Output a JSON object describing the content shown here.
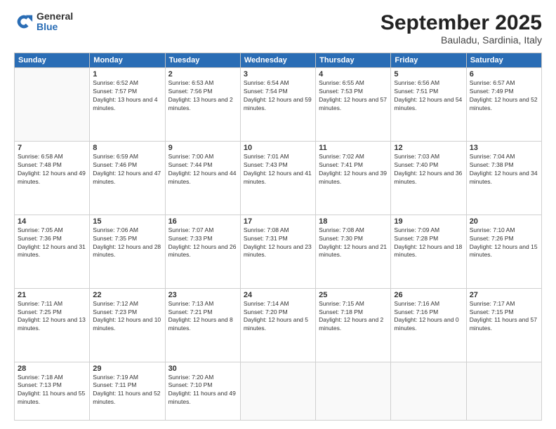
{
  "logo": {
    "general": "General",
    "blue": "Blue"
  },
  "header": {
    "month": "September 2025",
    "location": "Bauladu, Sardinia, Italy"
  },
  "days_of_week": [
    "Sunday",
    "Monday",
    "Tuesday",
    "Wednesday",
    "Thursday",
    "Friday",
    "Saturday"
  ],
  "weeks": [
    [
      {
        "day": "",
        "sunrise": "",
        "sunset": "",
        "daylight": ""
      },
      {
        "day": "1",
        "sunrise": "Sunrise: 6:52 AM",
        "sunset": "Sunset: 7:57 PM",
        "daylight": "Daylight: 13 hours and 4 minutes."
      },
      {
        "day": "2",
        "sunrise": "Sunrise: 6:53 AM",
        "sunset": "Sunset: 7:56 PM",
        "daylight": "Daylight: 13 hours and 2 minutes."
      },
      {
        "day": "3",
        "sunrise": "Sunrise: 6:54 AM",
        "sunset": "Sunset: 7:54 PM",
        "daylight": "Daylight: 12 hours and 59 minutes."
      },
      {
        "day": "4",
        "sunrise": "Sunrise: 6:55 AM",
        "sunset": "Sunset: 7:53 PM",
        "daylight": "Daylight: 12 hours and 57 minutes."
      },
      {
        "day": "5",
        "sunrise": "Sunrise: 6:56 AM",
        "sunset": "Sunset: 7:51 PM",
        "daylight": "Daylight: 12 hours and 54 minutes."
      },
      {
        "day": "6",
        "sunrise": "Sunrise: 6:57 AM",
        "sunset": "Sunset: 7:49 PM",
        "daylight": "Daylight: 12 hours and 52 minutes."
      }
    ],
    [
      {
        "day": "7",
        "sunrise": "Sunrise: 6:58 AM",
        "sunset": "Sunset: 7:48 PM",
        "daylight": "Daylight: 12 hours and 49 minutes."
      },
      {
        "day": "8",
        "sunrise": "Sunrise: 6:59 AM",
        "sunset": "Sunset: 7:46 PM",
        "daylight": "Daylight: 12 hours and 47 minutes."
      },
      {
        "day": "9",
        "sunrise": "Sunrise: 7:00 AM",
        "sunset": "Sunset: 7:44 PM",
        "daylight": "Daylight: 12 hours and 44 minutes."
      },
      {
        "day": "10",
        "sunrise": "Sunrise: 7:01 AM",
        "sunset": "Sunset: 7:43 PM",
        "daylight": "Daylight: 12 hours and 41 minutes."
      },
      {
        "day": "11",
        "sunrise": "Sunrise: 7:02 AM",
        "sunset": "Sunset: 7:41 PM",
        "daylight": "Daylight: 12 hours and 39 minutes."
      },
      {
        "day": "12",
        "sunrise": "Sunrise: 7:03 AM",
        "sunset": "Sunset: 7:40 PM",
        "daylight": "Daylight: 12 hours and 36 minutes."
      },
      {
        "day": "13",
        "sunrise": "Sunrise: 7:04 AM",
        "sunset": "Sunset: 7:38 PM",
        "daylight": "Daylight: 12 hours and 34 minutes."
      }
    ],
    [
      {
        "day": "14",
        "sunrise": "Sunrise: 7:05 AM",
        "sunset": "Sunset: 7:36 PM",
        "daylight": "Daylight: 12 hours and 31 minutes."
      },
      {
        "day": "15",
        "sunrise": "Sunrise: 7:06 AM",
        "sunset": "Sunset: 7:35 PM",
        "daylight": "Daylight: 12 hours and 28 minutes."
      },
      {
        "day": "16",
        "sunrise": "Sunrise: 7:07 AM",
        "sunset": "Sunset: 7:33 PM",
        "daylight": "Daylight: 12 hours and 26 minutes."
      },
      {
        "day": "17",
        "sunrise": "Sunrise: 7:08 AM",
        "sunset": "Sunset: 7:31 PM",
        "daylight": "Daylight: 12 hours and 23 minutes."
      },
      {
        "day": "18",
        "sunrise": "Sunrise: 7:08 AM",
        "sunset": "Sunset: 7:30 PM",
        "daylight": "Daylight: 12 hours and 21 minutes."
      },
      {
        "day": "19",
        "sunrise": "Sunrise: 7:09 AM",
        "sunset": "Sunset: 7:28 PM",
        "daylight": "Daylight: 12 hours and 18 minutes."
      },
      {
        "day": "20",
        "sunrise": "Sunrise: 7:10 AM",
        "sunset": "Sunset: 7:26 PM",
        "daylight": "Daylight: 12 hours and 15 minutes."
      }
    ],
    [
      {
        "day": "21",
        "sunrise": "Sunrise: 7:11 AM",
        "sunset": "Sunset: 7:25 PM",
        "daylight": "Daylight: 12 hours and 13 minutes."
      },
      {
        "day": "22",
        "sunrise": "Sunrise: 7:12 AM",
        "sunset": "Sunset: 7:23 PM",
        "daylight": "Daylight: 12 hours and 10 minutes."
      },
      {
        "day": "23",
        "sunrise": "Sunrise: 7:13 AM",
        "sunset": "Sunset: 7:21 PM",
        "daylight": "Daylight: 12 hours and 8 minutes."
      },
      {
        "day": "24",
        "sunrise": "Sunrise: 7:14 AM",
        "sunset": "Sunset: 7:20 PM",
        "daylight": "Daylight: 12 hours and 5 minutes."
      },
      {
        "day": "25",
        "sunrise": "Sunrise: 7:15 AM",
        "sunset": "Sunset: 7:18 PM",
        "daylight": "Daylight: 12 hours and 2 minutes."
      },
      {
        "day": "26",
        "sunrise": "Sunrise: 7:16 AM",
        "sunset": "Sunset: 7:16 PM",
        "daylight": "Daylight: 12 hours and 0 minutes."
      },
      {
        "day": "27",
        "sunrise": "Sunrise: 7:17 AM",
        "sunset": "Sunset: 7:15 PM",
        "daylight": "Daylight: 11 hours and 57 minutes."
      }
    ],
    [
      {
        "day": "28",
        "sunrise": "Sunrise: 7:18 AM",
        "sunset": "Sunset: 7:13 PM",
        "daylight": "Daylight: 11 hours and 55 minutes."
      },
      {
        "day": "29",
        "sunrise": "Sunrise: 7:19 AM",
        "sunset": "Sunset: 7:11 PM",
        "daylight": "Daylight: 11 hours and 52 minutes."
      },
      {
        "day": "30",
        "sunrise": "Sunrise: 7:20 AM",
        "sunset": "Sunset: 7:10 PM",
        "daylight": "Daylight: 11 hours and 49 minutes."
      },
      {
        "day": "",
        "sunrise": "",
        "sunset": "",
        "daylight": ""
      },
      {
        "day": "",
        "sunrise": "",
        "sunset": "",
        "daylight": ""
      },
      {
        "day": "",
        "sunrise": "",
        "sunset": "",
        "daylight": ""
      },
      {
        "day": "",
        "sunrise": "",
        "sunset": "",
        "daylight": ""
      }
    ]
  ]
}
